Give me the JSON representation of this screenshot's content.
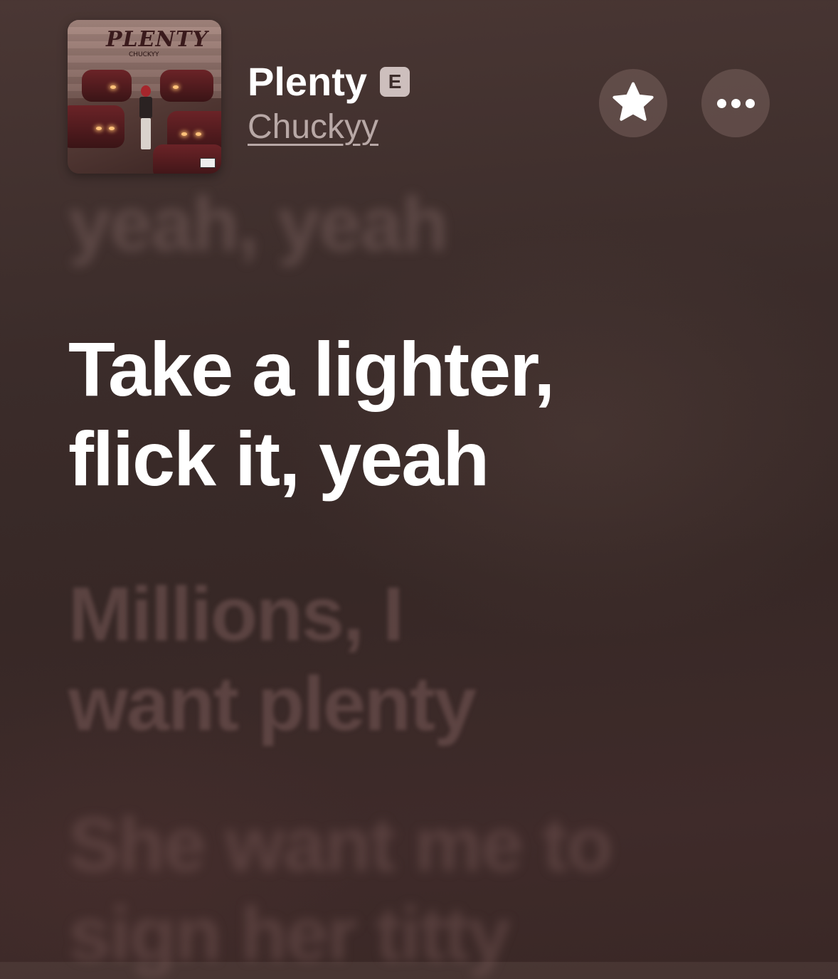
{
  "track": {
    "title": "Plenty",
    "explicit_badge": "E",
    "artist": "Chuckyy"
  },
  "artwork": {
    "title": "PLENTY",
    "subtitle": "CHUCKYY"
  },
  "lyrics": {
    "previous": [
      "yeah, yeah"
    ],
    "current": [
      "Take a lighter,",
      "flick it, yeah"
    ],
    "next": [
      "Millions, I",
      "want plenty"
    ],
    "next2": [
      "She want me to",
      "sign her titty"
    ]
  },
  "icons": {
    "favorite": "star-icon",
    "more": "more-icon"
  },
  "colors": {
    "background": "#3b2c2a",
    "active_lyric": "#ffffff",
    "badge": "#cdbfbd",
    "artist": "#b8a8a6"
  }
}
